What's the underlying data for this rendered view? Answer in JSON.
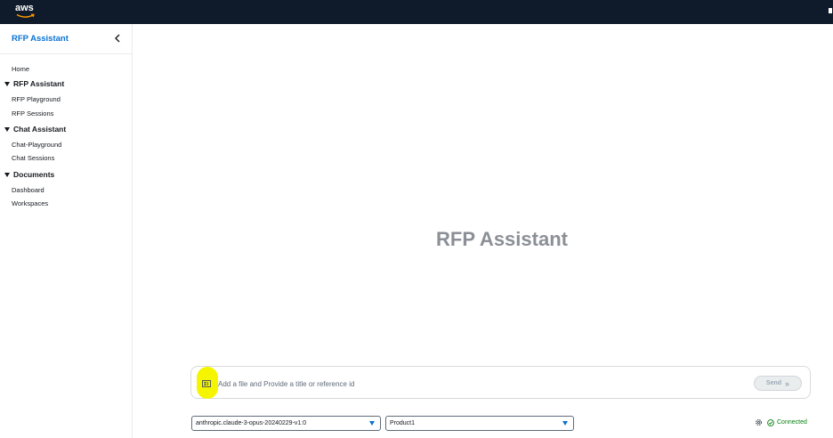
{
  "topbar": {
    "logo_text": "aws"
  },
  "sidebar": {
    "title": "RFP Assistant",
    "home": "Home",
    "sections": [
      {
        "label": "RFP Assistant",
        "items": [
          "RFP Playground",
          "RFP Sessions"
        ]
      },
      {
        "label": "Chat Assistant",
        "items": [
          "Chat-Playground",
          "Chat Sessions"
        ]
      },
      {
        "label": "Documents",
        "items": [
          "Dashboard",
          "Workspaces"
        ]
      }
    ]
  },
  "main": {
    "hero_title": "RFP Assistant",
    "prompt": {
      "placeholder": "Add a file and Provide a title or reference id",
      "value": ""
    },
    "send_label": "Send",
    "model_select": "anthropic.claude-3-opus-20240229-v1:0",
    "product_select": "Product1",
    "status": "Connected"
  },
  "colors": {
    "accent": "#0972d3",
    "topbar": "#0f1b2a",
    "success": "#037f0c",
    "highlight": "#f5f500"
  }
}
